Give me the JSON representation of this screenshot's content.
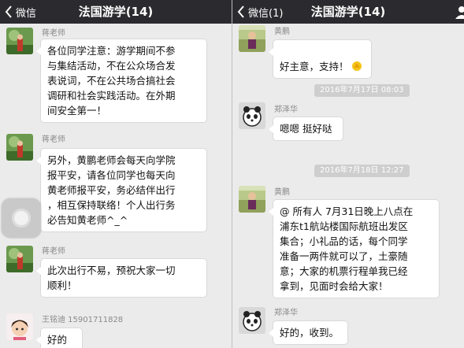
{
  "left": {
    "nav": {
      "back": "微信",
      "title": "法国游学(14)"
    },
    "messages": [
      {
        "sender": "蒋老师",
        "text": "各位同学注意：游学期间不参\n与集结活动，不在公众场合发\n表说词，不在公共场合搞社会\n调研和社会实践活动。在外期\n间安全第一！"
      },
      {
        "sender": "蒋老师",
        "text": "另外，黄鹏老师会每天向学院\n报平安，请各位同学也每天向\n黄老师报平安，务必结伴出行\n，相互保持联络！个人出行务\n必告知黄老师^_^"
      },
      {
        "sender": "蒋老师",
        "text": "此次出行不易，预祝大家一切\n顺利！"
      },
      {
        "sender": "王铭迪 15901711828",
        "text": "好的"
      }
    ]
  },
  "right": {
    "nav": {
      "back": "微信(1)",
      "title": "法国游学(14)"
    },
    "messages": [
      {
        "sender": "黄鹏",
        "text": "好主意，支持！"
      },
      {
        "time": "2016年7月17日 08:03"
      },
      {
        "sender": "郑泽华",
        "text": "嗯嗯 挺好哒"
      },
      {
        "time": "2016年7月18日 12:27"
      },
      {
        "sender": "黄鹏",
        "text": "@ 所有人 7月31日晚上八点在\n浦东t1航站楼国际航班出发区\n集合；小礼品的话，每个同学\n准备一两件就可以了，土豪随\n意；大家的机票行程单我已经\n拿到，见面时会给大家！"
      },
      {
        "sender": "郑泽华",
        "text": "好的，收到。"
      }
    ]
  },
  "colors": {
    "navbar": "#2b2b2f",
    "chat_bg": "#ebebeb",
    "bubble": "#ffffff",
    "time_badge": "#cecece"
  }
}
